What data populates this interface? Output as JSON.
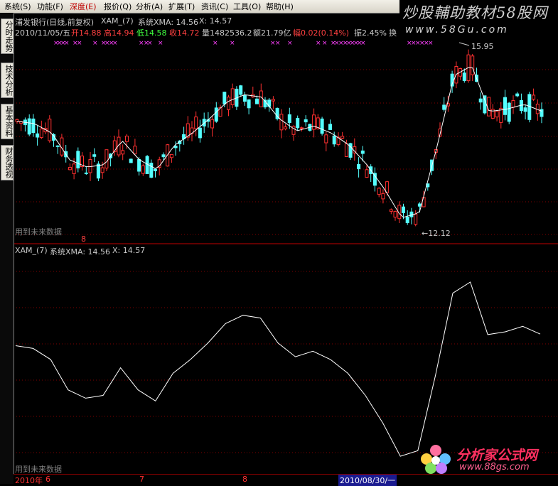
{
  "menu": [
    {
      "label": "系统(S)",
      "active": false
    },
    {
      "label": "功能(F)",
      "active": false
    },
    {
      "label": "深度(E)",
      "active": true
    },
    {
      "label": "报价(Q)",
      "active": false
    },
    {
      "label": "分析(A)",
      "active": false
    },
    {
      "label": "扩展(T)",
      "active": false
    },
    {
      "label": "资讯(C)",
      "active": false
    },
    {
      "label": "工具(O)",
      "active": false
    },
    {
      "label": "帮助(H)",
      "active": false
    }
  ],
  "brand": {
    "title": "炒股輔助教材58股网",
    "url": "www.58Gu.com"
  },
  "sidebar": [
    {
      "label": "分时走势"
    },
    {
      "label": "技术分析"
    },
    {
      "label": "基本资料"
    },
    {
      "label": "财务透视"
    }
  ],
  "header": {
    "stock_name": "浦发银行(日线,前复权)",
    "indicator": "XAM_(7)",
    "xma_label": "系统XMA: 14.56",
    "x_label": "X: 14.57",
    "date": "2010/11/05/五",
    "open": "开14.88",
    "high": "高14.94",
    "low": "低14.58",
    "close": "收14.72",
    "volume": "量1482536.2",
    "amount": "额21.79亿",
    "change": "幅0.02(0.14%)",
    "amplitude": "振2.45%",
    "extra": "换"
  },
  "price_chart": {
    "high_label": "15.95",
    "low_label": "←12.12",
    "future_note": "用到未来数据",
    "marker": "8"
  },
  "lower": {
    "indicator": "XAM_(7)",
    "xma_label": "系统XMA: 14.56",
    "x_label": "X: 14.57",
    "future_note": "用到未来数据"
  },
  "dates": [
    {
      "label": "2010年",
      "selected": false
    },
    {
      "label": "6",
      "selected": false
    },
    {
      "label": "7",
      "selected": false
    },
    {
      "label": "8",
      "selected": false
    },
    {
      "label": "2010/08/30/一",
      "selected": true
    }
  ],
  "watermark": {
    "title": "分析家公式网",
    "url": "www.88gs.com"
  },
  "colors": {
    "up": "#ff3030",
    "down": "#54ffff",
    "ma": "#ffffff",
    "grid": "#800000",
    "panel_border": "#c00000"
  },
  "chart_data": {
    "type": "line",
    "series": [
      {
        "name": "XMA",
        "values": [
          14.35,
          14.3,
          14.1,
          13.55,
          13.4,
          13.45,
          13.95,
          13.55,
          13.35,
          13.85,
          14.1,
          14.4,
          14.75,
          14.9,
          14.85,
          14.4,
          14.15,
          14.25,
          14.1,
          13.85,
          13.45,
          12.95,
          12.35,
          12.45,
          13.8,
          15.3,
          15.5,
          14.55,
          14.6,
          14.7,
          14.56
        ]
      }
    ]
  }
}
